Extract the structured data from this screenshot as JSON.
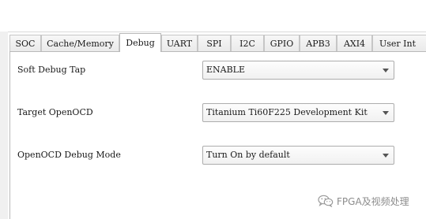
{
  "tabs": [
    {
      "label": "SOC"
    },
    {
      "label": "Cache/Memory"
    },
    {
      "label": "Debug"
    },
    {
      "label": "UART"
    },
    {
      "label": "SPI"
    },
    {
      "label": "I2C"
    },
    {
      "label": "GPIO"
    },
    {
      "label": "APB3"
    },
    {
      "label": "AXI4"
    },
    {
      "label": "User Int"
    }
  ],
  "active_tab": "Debug",
  "fields": {
    "soft_debug_tap": {
      "label": "Soft Debug Tap",
      "value": "ENABLE"
    },
    "target_openocd": {
      "label": "Target OpenOCD",
      "value": "Titanium Ti60F225 Development Kit"
    },
    "openocd_debug_mode": {
      "label": "OpenOCD Debug Mode",
      "value": "Turn On by default"
    }
  },
  "watermark": {
    "text": "FPGA及视频处理",
    "icon": "wechat-icon"
  },
  "colors": {
    "tab_border": "#c6c6c6",
    "panel_border": "#b9b9b9",
    "combo_border": "#adadad",
    "watermark": "#8c8c8c"
  }
}
